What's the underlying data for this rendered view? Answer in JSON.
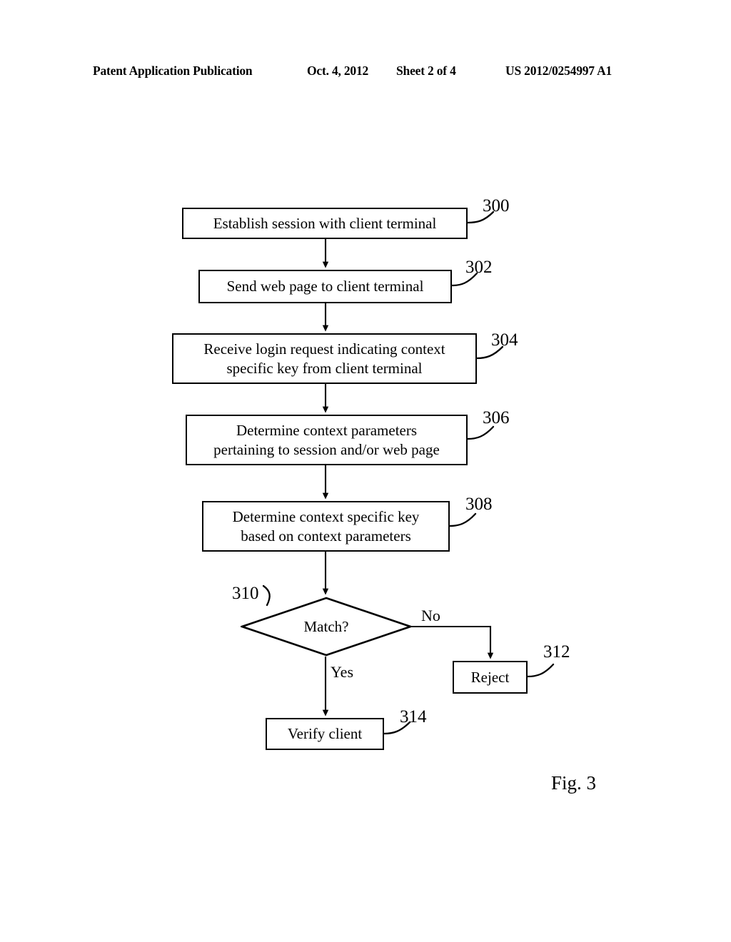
{
  "header": {
    "publication": "Patent Application Publication",
    "date": "Oct. 4, 2012",
    "sheet": "Sheet 2 of 4",
    "patent_number": "US 2012/0254997 A1"
  },
  "figure": {
    "caption": "Fig. 3",
    "nodes": [
      {
        "ref": "300",
        "type": "process",
        "line1": "Establish session with client terminal",
        "line2": ""
      },
      {
        "ref": "302",
        "type": "process",
        "line1": "Send web page to client terminal",
        "line2": ""
      },
      {
        "ref": "304",
        "type": "process",
        "line1": "Receive login request indicating context",
        "line2": "specific key from client terminal"
      },
      {
        "ref": "306",
        "type": "process",
        "line1": "Determine context parameters",
        "line2": "pertaining to session and/or web page"
      },
      {
        "ref": "308",
        "type": "process",
        "line1": "Determine context specific key",
        "line2": "based on context parameters"
      },
      {
        "ref": "310",
        "type": "decision",
        "line1": "Match?",
        "line2": ""
      },
      {
        "ref": "312",
        "type": "process",
        "line1": "Reject",
        "line2": ""
      },
      {
        "ref": "314",
        "type": "process",
        "line1": "Verify client",
        "line2": ""
      }
    ],
    "branch_labels": {
      "no": "No",
      "yes": "Yes"
    }
  },
  "colors": {
    "ink": "#000000",
    "paper": "#ffffff"
  }
}
